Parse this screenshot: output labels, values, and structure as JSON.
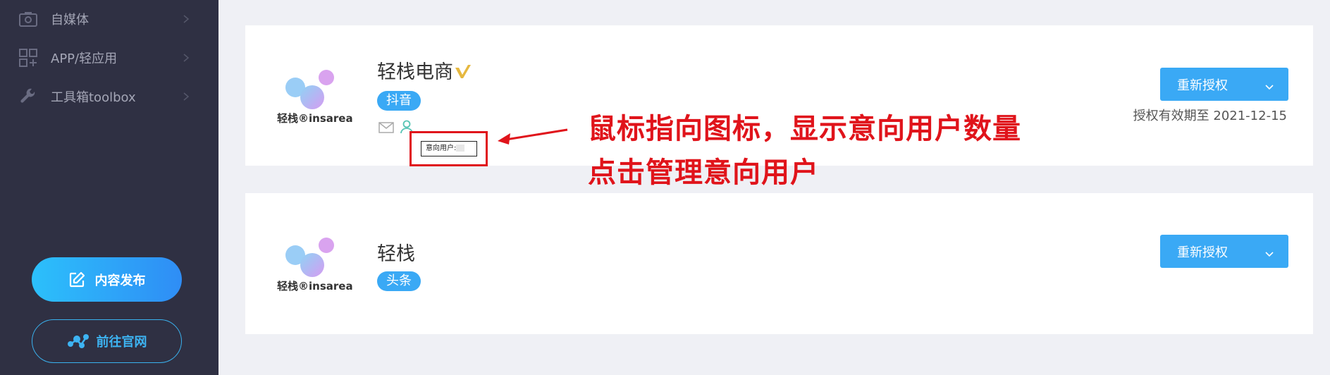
{
  "sidebar": {
    "items": [
      {
        "label": "自媒体",
        "icon": "media-icon"
      },
      {
        "label": "APP/轻应用",
        "icon": "app-grid-icon"
      },
      {
        "label": "工具箱toolbox",
        "icon": "wrench-icon"
      }
    ],
    "publish_label": "内容发布",
    "website_label": "前往官网"
  },
  "accounts": [
    {
      "name": "轻栈电商",
      "platform_tag": "抖音",
      "logo_text": "轻栈®insarea",
      "reauth_label": "重新授权",
      "expire_text": "授权有效期至 2021-12-15",
      "tooltip_label": "意向用户:",
      "verified": true
    },
    {
      "name": "轻栈",
      "platform_tag": "头条",
      "logo_text": "轻栈®insarea",
      "reauth_label": "重新授权"
    }
  ],
  "annotation": {
    "line1": "鼠标指向图标，显示意向用户数量",
    "line2": "点击管理意向用户"
  },
  "colors": {
    "sidebar_bg": "#2f3043",
    "accent": "#3aa9f5",
    "annotation_red": "#e0141b"
  }
}
